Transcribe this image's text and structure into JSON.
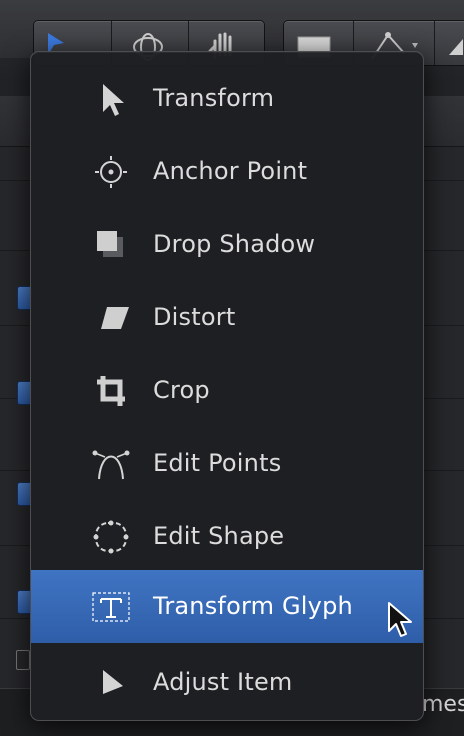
{
  "menu": {
    "items": [
      {
        "label": "Transform",
        "icon": "arrow-pointer-icon",
        "selected": false
      },
      {
        "label": "Anchor Point",
        "icon": "anchor-point-icon",
        "selected": false
      },
      {
        "label": "Drop Shadow",
        "icon": "drop-shadow-icon",
        "selected": false
      },
      {
        "label": "Distort",
        "icon": "distort-icon",
        "selected": false
      },
      {
        "label": "Crop",
        "icon": "crop-icon",
        "selected": false
      },
      {
        "label": "Edit Points",
        "icon": "edit-points-icon",
        "selected": false
      },
      {
        "label": "Edit Shape",
        "icon": "edit-shape-icon",
        "selected": false
      },
      {
        "label": "Transform Glyph",
        "icon": "transform-glyph-icon",
        "selected": true
      },
      {
        "label": "Adjust Item",
        "icon": "adjust-item-icon",
        "selected": false
      }
    ]
  },
  "background": {
    "partial_text": "mes"
  },
  "colors": {
    "menu_background": "#1e1f22",
    "selection_blue": "#3a6cb8",
    "label_text": "#dcdcdc"
  }
}
